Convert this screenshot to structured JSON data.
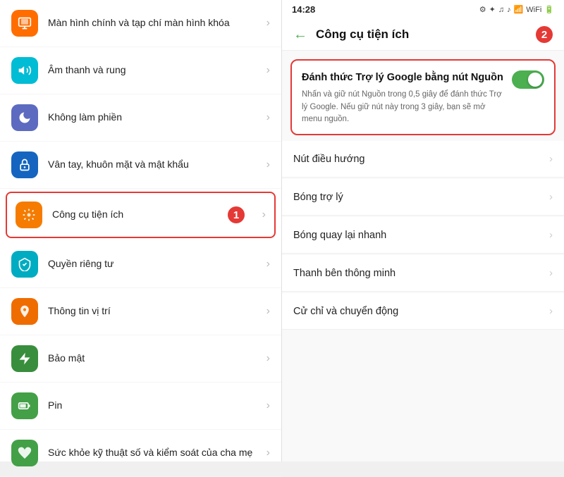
{
  "left": {
    "items": [
      {
        "id": "screen",
        "label": "Màn hình chính và tạp chí màn hình khóa",
        "icon_color": "icon-orange",
        "icon_symbol": "🖼",
        "highlighted": false
      },
      {
        "id": "sound",
        "label": "Âm thanh và rung",
        "icon_color": "icon-teal",
        "icon_symbol": "🔔",
        "highlighted": false
      },
      {
        "id": "dnd",
        "label": "Không làm phiền",
        "icon_color": "icon-indigo",
        "icon_symbol": "🌙",
        "highlighted": false
      },
      {
        "id": "biometrics",
        "label": "Vân tay, khuôn mặt và mật khẩu",
        "icon_color": "icon-blue",
        "icon_symbol": "🔒",
        "highlighted": false
      },
      {
        "id": "tools",
        "label": "Công cụ tiện ích",
        "icon_color": "icon-amber",
        "icon_symbol": "⚙",
        "highlighted": true,
        "badge": "1"
      },
      {
        "id": "privacy",
        "label": "Quyền riêng tư",
        "icon_color": "icon-cyan",
        "icon_symbol": "🛡",
        "highlighted": false
      },
      {
        "id": "location",
        "label": "Thông tin vị trí",
        "icon_color": "icon-yellow-orange",
        "icon_symbol": "📍",
        "highlighted": false
      },
      {
        "id": "security",
        "label": "Bảo mật",
        "icon_color": "icon-green-dark",
        "icon_symbol": "⚡",
        "highlighted": false
      },
      {
        "id": "battery",
        "label": "Pin",
        "icon_color": "icon-green",
        "icon_symbol": "🔋",
        "highlighted": false
      },
      {
        "id": "health",
        "label": "Sức khỏe kỹ thuật số và kiểm soát của cha mẹ",
        "icon_color": "icon-green",
        "icon_symbol": "💚",
        "highlighted": false
      }
    ]
  },
  "right": {
    "status_bar": {
      "time": "14:28",
      "icons": "🔧 ✦ 🎵 ♪ 📶 🔋"
    },
    "title": "Công cụ tiện ích",
    "back_label": "←",
    "badge": "2",
    "featured": {
      "title": "Đánh thức Trợ lý Google bằng nút Nguồn",
      "description": "Nhấn và giữ nút Nguồn trong 0,5 giây để đánh thức Trợ lý Google. Nếu giữ nút này trong 3 giây, bạn sẽ mở menu nguồn.",
      "toggle_on": true
    },
    "menu_items": [
      {
        "id": "nav-button",
        "label": "Nút điều hướng"
      },
      {
        "id": "assistant-ball",
        "label": "Bóng trợ lý"
      },
      {
        "id": "quick-ball",
        "label": "Bóng quay lại nhanh"
      },
      {
        "id": "smart-sidebar",
        "label": "Thanh bên thông minh"
      },
      {
        "id": "gestures",
        "label": "Cử chỉ và chuyển động"
      }
    ]
  }
}
